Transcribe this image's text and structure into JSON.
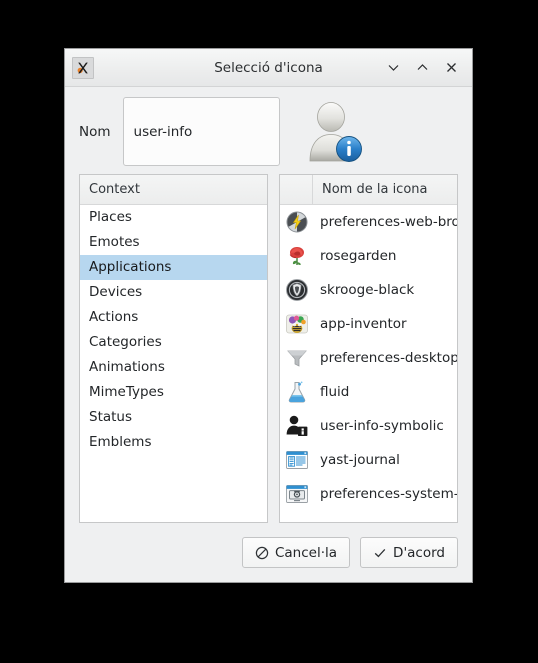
{
  "window": {
    "title": "Selecció d'icona",
    "app_icon": "x-logo-icon",
    "controls": {
      "minimize": "chevron-down-icon",
      "maximize": "chevron-up-icon",
      "close": "close-icon"
    }
  },
  "form": {
    "name_label": "Nom",
    "name_value": "user-info",
    "name_placeholder": "",
    "preview_icon": "user-info-preview-icon"
  },
  "context_pane": {
    "header": "Context",
    "items": [
      {
        "label": "Places",
        "selected": false
      },
      {
        "label": "Emotes",
        "selected": false
      },
      {
        "label": "Applications",
        "selected": true
      },
      {
        "label": "Devices",
        "selected": false
      },
      {
        "label": "Actions",
        "selected": false
      },
      {
        "label": "Categories",
        "selected": false
      },
      {
        "label": "Animations",
        "selected": false
      },
      {
        "label": "MimeTypes",
        "selected": false
      },
      {
        "label": "Status",
        "selected": false
      },
      {
        "label": "Emblems",
        "selected": false
      }
    ]
  },
  "icon_pane": {
    "header_icon_column": "",
    "header_name": "Nom de la icona",
    "items": [
      {
        "name": "preferences-web-browser",
        "icon": "web-browser-globe-icon"
      },
      {
        "name": "rosegarden",
        "icon": "rose-flower-icon"
      },
      {
        "name": "skrooge-black",
        "icon": "shield-circle-icon"
      },
      {
        "name": "app-inventor",
        "icon": "bee-flowers-icon"
      },
      {
        "name": "preferences-desktop-filter",
        "icon": "funnel-icon"
      },
      {
        "name": "fluid",
        "icon": "flask-icon"
      },
      {
        "name": "user-info-symbolic",
        "icon": "user-info-symbolic-icon"
      },
      {
        "name": "yast-journal",
        "icon": "window-text-lines-icon"
      },
      {
        "name": "preferences-system-network",
        "icon": "window-monitor-icon"
      }
    ]
  },
  "footer": {
    "cancel_label": "Cancel·la",
    "cancel_icon": "cancel-circle-slash-icon",
    "ok_label": "D'acord",
    "ok_icon": "check-icon"
  },
  "colors": {
    "desktop_background": "#000000",
    "dialog_background": "#eff0f1",
    "selection": "#b7d7ef",
    "text": "#232629",
    "accent_blue": "#2a7fc9"
  }
}
